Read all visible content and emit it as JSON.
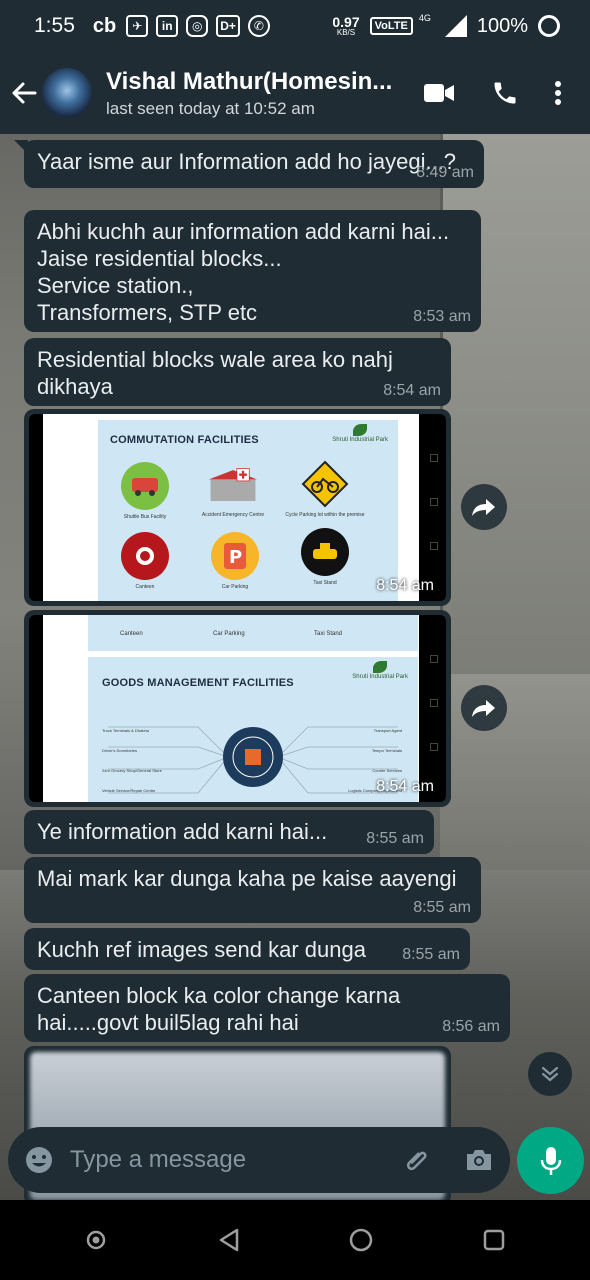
{
  "status_bar": {
    "time": "1:55",
    "app_icons": [
      "cb",
      "bag-icon",
      "in",
      "instagram-icon",
      "D+",
      "whatsapp-icon"
    ],
    "speed_value": "0.97",
    "speed_unit": "KB/S",
    "volte": "VoLTE",
    "network": "4G",
    "battery": "100%"
  },
  "header": {
    "contact_name": "Vishal Mathur(Homesin...",
    "last_seen": "last seen today at 10:52 am",
    "icons": [
      "back-arrow-icon",
      "video-call-icon",
      "phone-icon",
      "more-vert-icon"
    ]
  },
  "messages": [
    {
      "text": "Yaar isme aur Information add ho jayegi...?",
      "time": "8:49 am"
    },
    {
      "text": "Abhi kuchh aur information add karni hai...\nJaise residential blocks...\nService station.,\nTransformers, STP etc",
      "time": "8:53 am"
    },
    {
      "text": "Residential blocks wale area ko nahj\ndikhaya",
      "time": "8:54 am"
    },
    {
      "image": "commutation",
      "time": "8:54 am"
    },
    {
      "image": "goods",
      "time": "8:54 am"
    },
    {
      "text": "Ye information add karni hai...",
      "time": "8:55 am"
    },
    {
      "text": "Mai mark kar dunga kaha pe kaise aayengi",
      "time": "8:55 am"
    },
    {
      "text": "Kuchh ref images send kar dunga",
      "time": "8:55 am"
    },
    {
      "text": "Canteen block ka color change karna\nhai.....govt buil5lag rahi hai",
      "time": "8:56 am"
    }
  ],
  "image1": {
    "title": "COMMUTATION FACILITIES",
    "logo": "Shruti Industrial Park",
    "items": [
      "Shuttle Bus Facility",
      "Accident Emergency Centre",
      "Cycle Parking lot within the premise",
      "Canteen",
      "Car Parking",
      "Taxi Stand"
    ]
  },
  "image2": {
    "top_items": [
      "Canteen",
      "Car Parking",
      "Taxi Stand"
    ],
    "title": "GOODS MANAGEMENT FACILITIES",
    "logo": "Shruti Industrial Park",
    "left_items": [
      "Truck Terminals & Dhabha",
      "Driver's Dormitories",
      "24hr Grocery Shop/General Store",
      "Vehicle Service/Repair Centre"
    ],
    "right_items": [
      "Transport Agent",
      "Tempo Terminals",
      "Courier Services",
      "Logistic Company Department"
    ]
  },
  "input": {
    "placeholder": "Type a message",
    "icons": [
      "emoji-icon",
      "attach-icon",
      "camera-icon",
      "mic-icon"
    ]
  },
  "colors": {
    "bubble": "#1f2c34",
    "accent": "#00a884",
    "bar": "#1f2c34"
  }
}
